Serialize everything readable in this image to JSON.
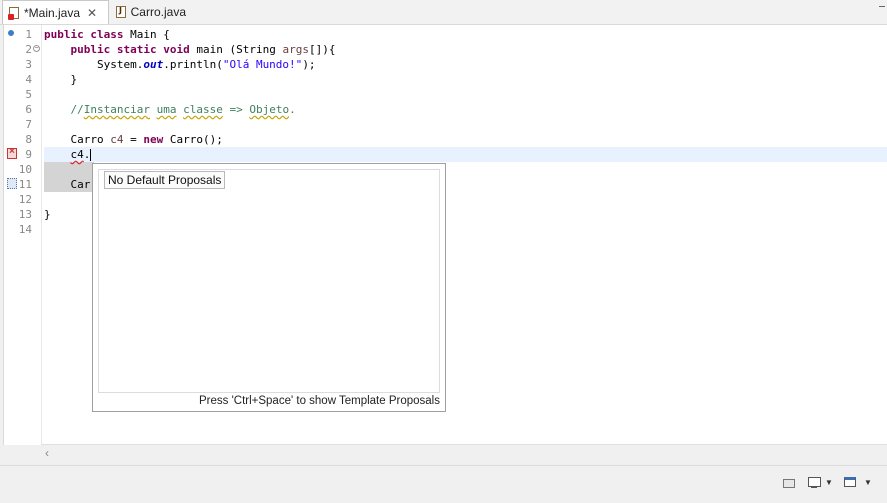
{
  "tabs": [
    {
      "label": "*Main.java",
      "active": true,
      "icon": "java-file-error-icon"
    },
    {
      "label": "Carro.java",
      "active": false,
      "icon": "java-file-icon"
    }
  ],
  "tab_close_glyph": "✕",
  "line_numbers": [
    "1",
    "2",
    "3",
    "4",
    "5",
    "6",
    "7",
    "8",
    "9",
    "10",
    "11",
    "12",
    "13",
    "14"
  ],
  "code": {
    "l1": {
      "kw1": "public",
      "kw2": "class",
      "rest": " Main {"
    },
    "l2": {
      "indent": "    ",
      "kw1": "public",
      "kw2": "static",
      "kw3": "void",
      "mid": " main (String ",
      "param": "args",
      "rest": "[]){"
    },
    "l3": {
      "indent": "        ",
      "pre": "System.",
      "field": "out",
      "mid": ".println(",
      "str": "\"Olá Mundo!\"",
      "rest": ");"
    },
    "l4": {
      "text": "    }"
    },
    "l6": {
      "indent": "    ",
      "cm1": "//",
      "cm2": "Instanciar",
      "cm3": " ",
      "cm4": "uma",
      "cm5": " ",
      "cm6": "classe",
      "cm7": " => ",
      "cm8": "Objeto",
      "cm9": "."
    },
    "l8": {
      "indent": "    ",
      "type": "Carro ",
      "var": "c4",
      "mid": " = ",
      "kw": "new",
      "rest": " Carro();"
    },
    "l9": {
      "indent": "    ",
      "err": "c4",
      "rest": "."
    },
    "l11": {
      "indent": "    ",
      "text": "Car"
    },
    "l13": {
      "text": "}"
    }
  },
  "popup": {
    "proposal": "No Default Proposals",
    "status": "Press 'Ctrl+Space' to show Template Proposals"
  },
  "scroll_left_glyph": "‹",
  "toolbar_chevron": "▼",
  "colors": {
    "keyword": "#7f0055",
    "string": "#2a00ff",
    "comment": "#3f7f5f",
    "field": "#0000c0"
  }
}
